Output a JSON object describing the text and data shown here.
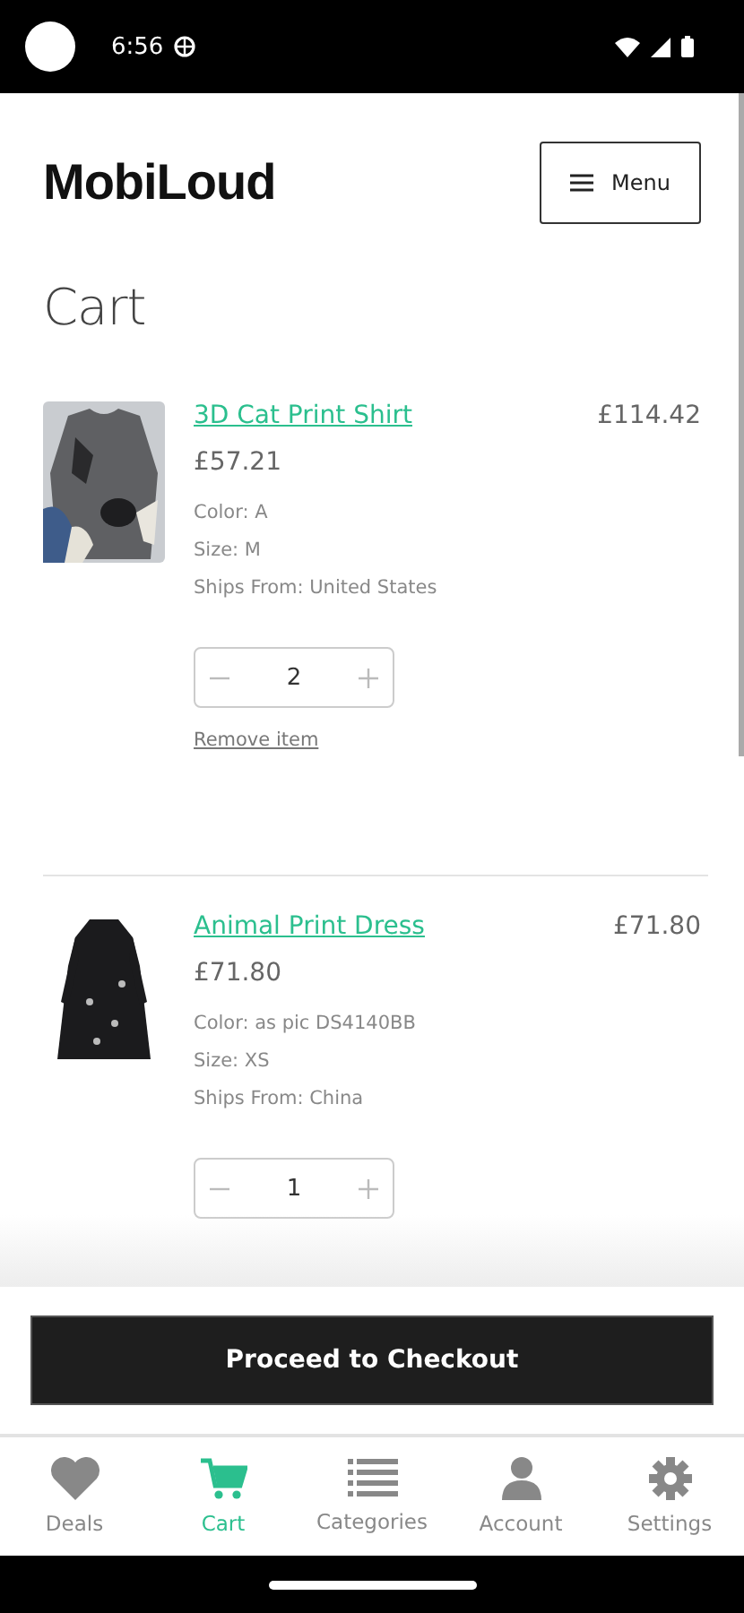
{
  "status_bar": {
    "time": "6:56"
  },
  "header": {
    "logo": "MobiLoud",
    "menu_button": "Menu"
  },
  "page_title": "Cart",
  "items": [
    {
      "name": "3D Cat Print Shirt",
      "unit_price": "£57.21",
      "total": "£114.42",
      "attributes": [
        "Color: A",
        "Size: M",
        "Ships From: United States"
      ],
      "quantity": "2",
      "remove_link": "Remove item"
    },
    {
      "name": "Animal Print Dress",
      "unit_price": "£71.80",
      "total": "£71.80",
      "attributes": [
        "Color: as pic DS4140BB",
        "Size: XS",
        "Ships From: China"
      ],
      "quantity": "1"
    }
  ],
  "checkout_button": "Proceed to Checkout",
  "tabs": [
    {
      "label": "Deals",
      "selected": false
    },
    {
      "label": "Cart",
      "selected": true
    },
    {
      "label": "Categories",
      "selected": false
    },
    {
      "label": "Account",
      "selected": false
    },
    {
      "label": "Settings",
      "selected": false
    }
  ]
}
